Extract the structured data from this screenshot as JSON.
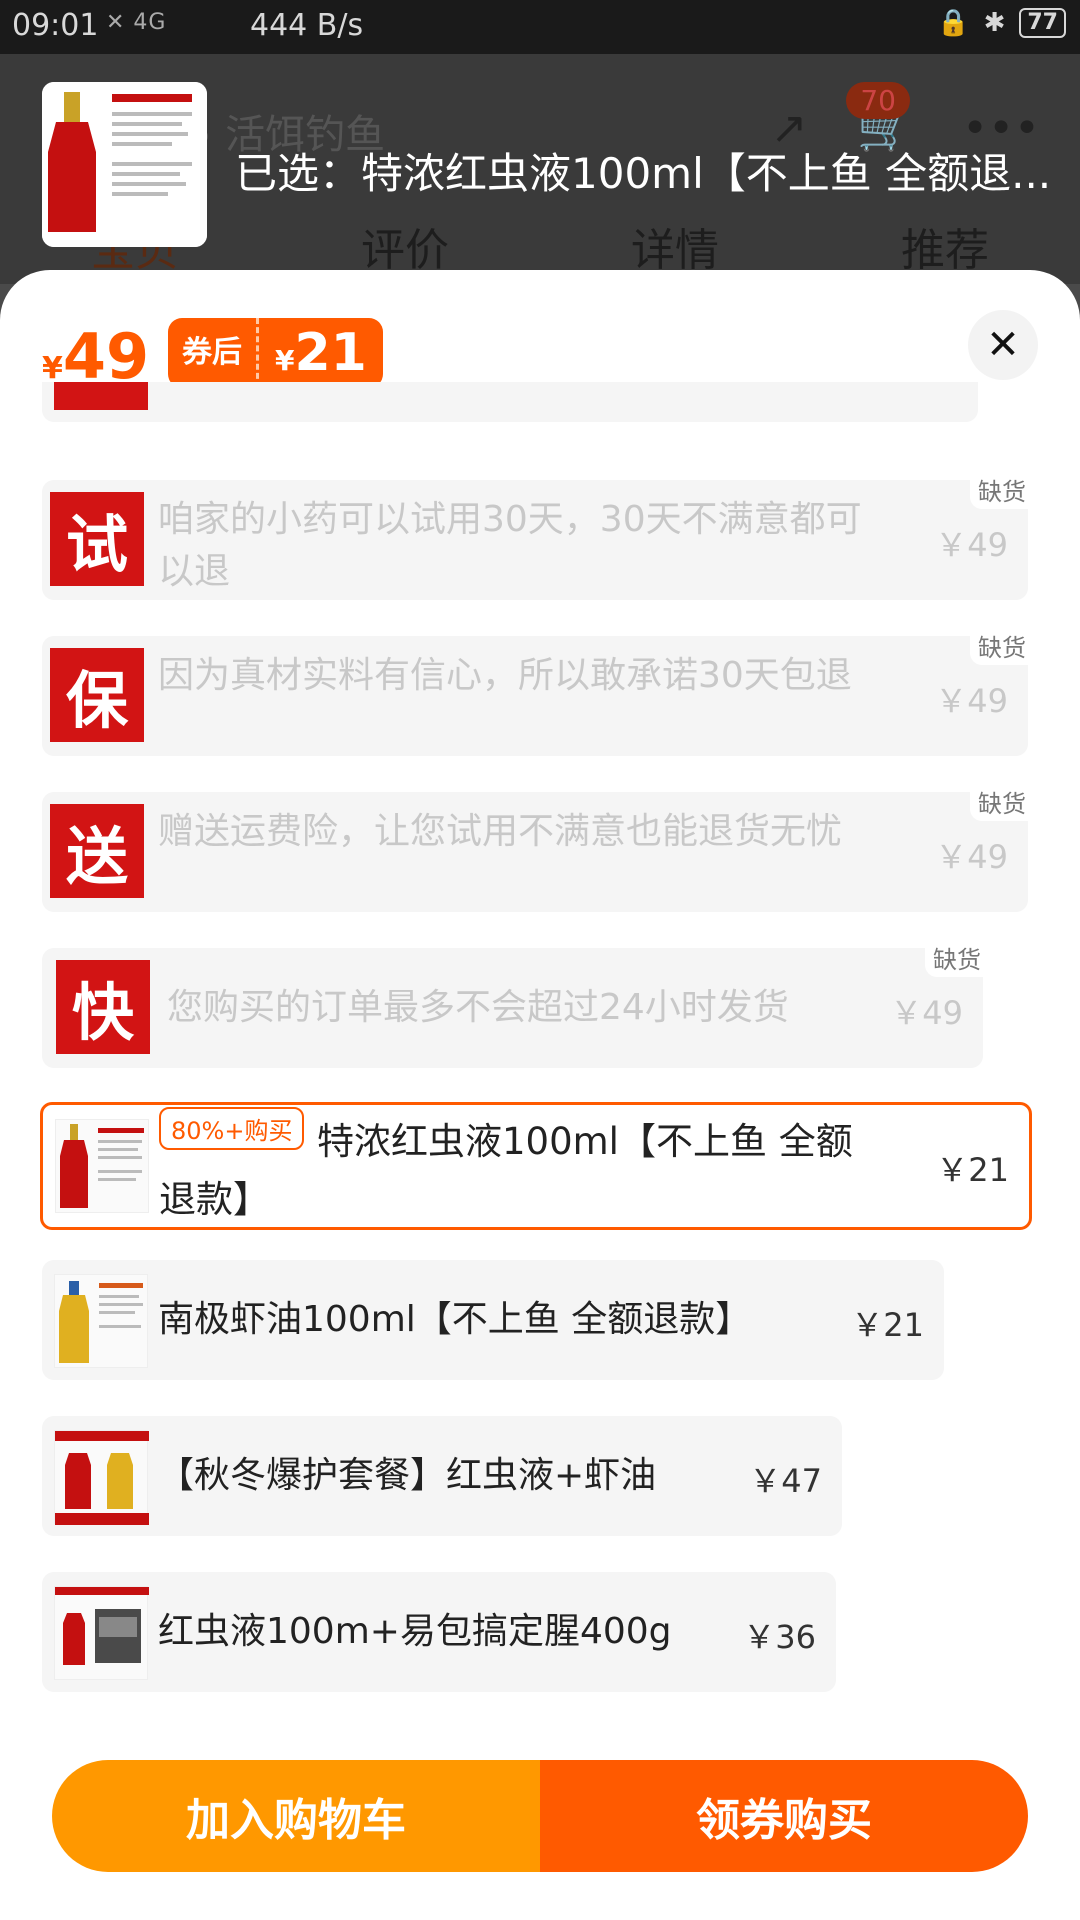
{
  "status_bar": {
    "time": "09:01",
    "signal": "✕ 4G",
    "net_speed": "444 B/s",
    "battery": "77"
  },
  "background": {
    "search_text": "活饵钓鱼",
    "cart_badge": "70",
    "tabs": [
      "宝贝",
      "评价",
      "详情",
      "推荐"
    ]
  },
  "selected": {
    "text": "已选：特浓红虫液100ml【不上鱼 全额退..."
  },
  "price": {
    "yen": "¥",
    "original": "49",
    "coupon_label": "券后",
    "coupon_yen": "¥",
    "coupon_price": "21"
  },
  "options": [
    {
      "thumb_char": "试",
      "label": "咱家的小药可以试用30天，30天不满意都可以退",
      "price": "￥49",
      "stock": "缺货"
    },
    {
      "thumb_char": "保",
      "label": "因为真材实料有信心，所以敢承诺30天包退",
      "price": "￥49",
      "stock": "缺货"
    },
    {
      "thumb_char": "送",
      "label": "赠送运费险，让您试用不满意也能退货无忧",
      "price": "￥49",
      "stock": "缺货"
    },
    {
      "thumb_char": "快",
      "label": "您购买的订单最多不会超过24小时发货",
      "price": "￥49",
      "stock": "缺货"
    },
    {
      "label": "特浓红虫液100ml【不上鱼 全额退款】",
      "price": "￥21",
      "badge": "80%+购买"
    },
    {
      "label": "南极虾油100ml【不上鱼 全额退款】",
      "price": "￥21"
    },
    {
      "label": "【秋冬爆护套餐】红虫液+虾油",
      "price": "￥47"
    },
    {
      "label": "红虫液100m+易包搞定腥400g",
      "price": "￥36"
    }
  ],
  "footer": {
    "add_cart": "加入购物车",
    "buy": "领券购买"
  },
  "colors": {
    "accent": "#ff5a00",
    "cart_button": "#ff9800"
  }
}
